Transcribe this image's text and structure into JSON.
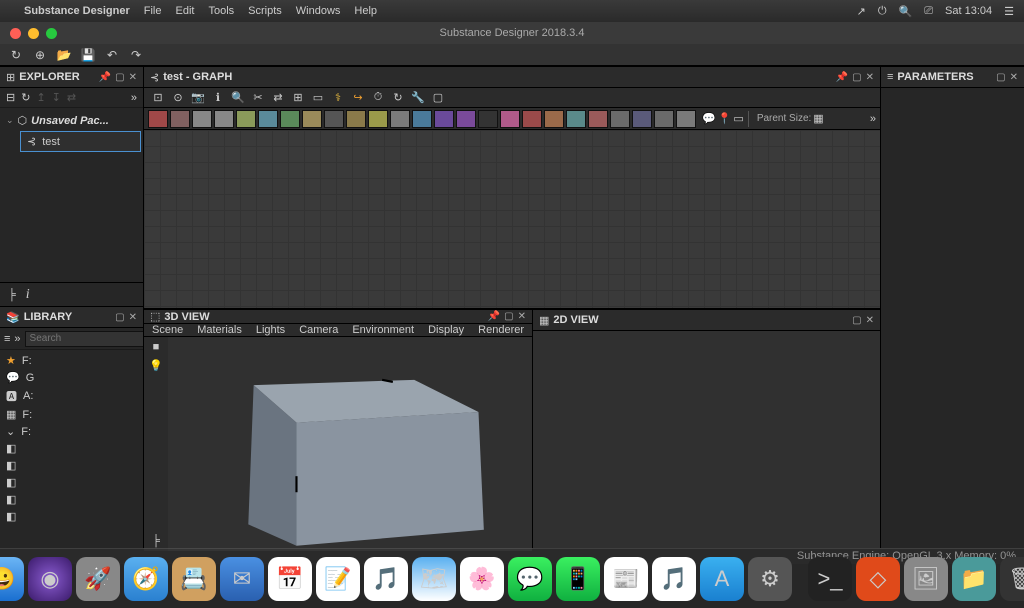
{
  "menubar": {
    "app": "Substance Designer",
    "items": [
      "File",
      "Edit",
      "Tools",
      "Scripts",
      "Windows",
      "Help"
    ],
    "clock": "Sat 13:04"
  },
  "titlebar": {
    "title": "Substance Designer 2018.3.4"
  },
  "explorer": {
    "title": "EXPLORER",
    "package": "Unsaved Pac...",
    "graph": "test"
  },
  "library": {
    "title": "LIBRARY",
    "search_placeholder": "Search",
    "cats": [
      "F:",
      "G",
      "A:",
      "F:",
      "F:"
    ]
  },
  "graph": {
    "title": "test - GRAPH",
    "parent_size": "Parent Size:"
  },
  "view3d": {
    "title": "3D VIEW",
    "menu": [
      "Scene",
      "Materials",
      "Lights",
      "Camera",
      "Environment",
      "Display",
      "Renderer"
    ]
  },
  "view2d": {
    "title": "2D VIEW"
  },
  "parameters": {
    "title": "PARAMETERS"
  },
  "status": {
    "text": "Substance Engine: OpenGL 3.x  Memory: 0%"
  },
  "node_colors": [
    "#a04848",
    "#806060",
    "#888",
    "#888",
    "#8a9a5a",
    "#5a8a9a",
    "#5a8a5a",
    "#9a8a5a",
    "#555",
    "#8a7a4a",
    "#9a9a4a",
    "#7a7a7a",
    "#4a7a9a",
    "#6a4a9a",
    "#7a4a9a",
    "#333",
    "#b05a8a",
    "#9a4a4a",
    "#9a6a4a",
    "#5a8a8a",
    "#9a5a5a",
    "#6a6a6a",
    "#5a5a7a",
    "#6a6a6a",
    "#7a7a7a"
  ],
  "dock": [
    {
      "bg": "linear-gradient(#6bb5f5,#1a6fd0)",
      "emoji": "😀"
    },
    {
      "bg": "radial-gradient(circle,#8a5cd0,#3a1a6a)",
      "emoji": "◉"
    },
    {
      "bg": "#888",
      "emoji": "🚀"
    },
    {
      "bg": "linear-gradient(#5ab0f0,#2a80d0)",
      "emoji": "🧭"
    },
    {
      "bg": "#d0a060",
      "emoji": "📇"
    },
    {
      "bg": "linear-gradient(#4a90e2,#2a60b0)",
      "emoji": "✉"
    },
    {
      "bg": "#fff",
      "emoji": "📅"
    },
    {
      "bg": "#fff",
      "emoji": "📝"
    },
    {
      "bg": "#fff",
      "emoji": "🎵"
    },
    {
      "bg": "linear-gradient(#5ab0f0,#fff)",
      "emoji": "🗺"
    },
    {
      "bg": "#fff",
      "emoji": "🌸"
    },
    {
      "bg": "linear-gradient(#3af060,#10b040)",
      "emoji": "💬"
    },
    {
      "bg": "linear-gradient(#3af060,#10b040)",
      "emoji": "📱"
    },
    {
      "bg": "#fff",
      "emoji": "📰"
    },
    {
      "bg": "#fff",
      "emoji": "🎵"
    },
    {
      "bg": "linear-gradient(#3ab0f0,#1a80d0)",
      "emoji": "A"
    },
    {
      "bg": "#555",
      "emoji": "⚙"
    }
  ],
  "dock_right": [
    {
      "bg": "#222",
      "emoji": ">_"
    },
    {
      "bg": "#e04a1a",
      "emoji": "◇"
    },
    {
      "bg": "#888",
      "emoji": "🖼"
    },
    {
      "bg": "#4a9a9a",
      "emoji": "📁"
    },
    {
      "bg": "#333",
      "emoji": "🗑"
    }
  ]
}
